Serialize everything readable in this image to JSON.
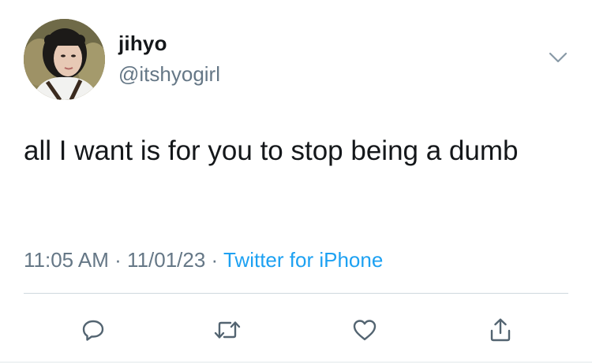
{
  "author": {
    "display_name": "jihyo",
    "handle": "@itshyogirl",
    "avatar_icon": "profile-photo"
  },
  "tweet": {
    "text": "all I want is for you to stop being a dumb"
  },
  "meta": {
    "time": "11:05 AM",
    "separator_1": " · ",
    "date": "11/01/23",
    "separator_2": " · ",
    "source": "Twitter for iPhone"
  },
  "actions": [
    {
      "name": "reply",
      "icon": "reply-icon"
    },
    {
      "name": "retweet",
      "icon": "retweet-icon"
    },
    {
      "name": "like",
      "icon": "heart-icon"
    },
    {
      "name": "share",
      "icon": "share-icon"
    }
  ],
  "colors": {
    "text_primary": "#14171a",
    "text_secondary": "#657786",
    "link": "#1da1f2",
    "divider": "#cfd9de"
  }
}
